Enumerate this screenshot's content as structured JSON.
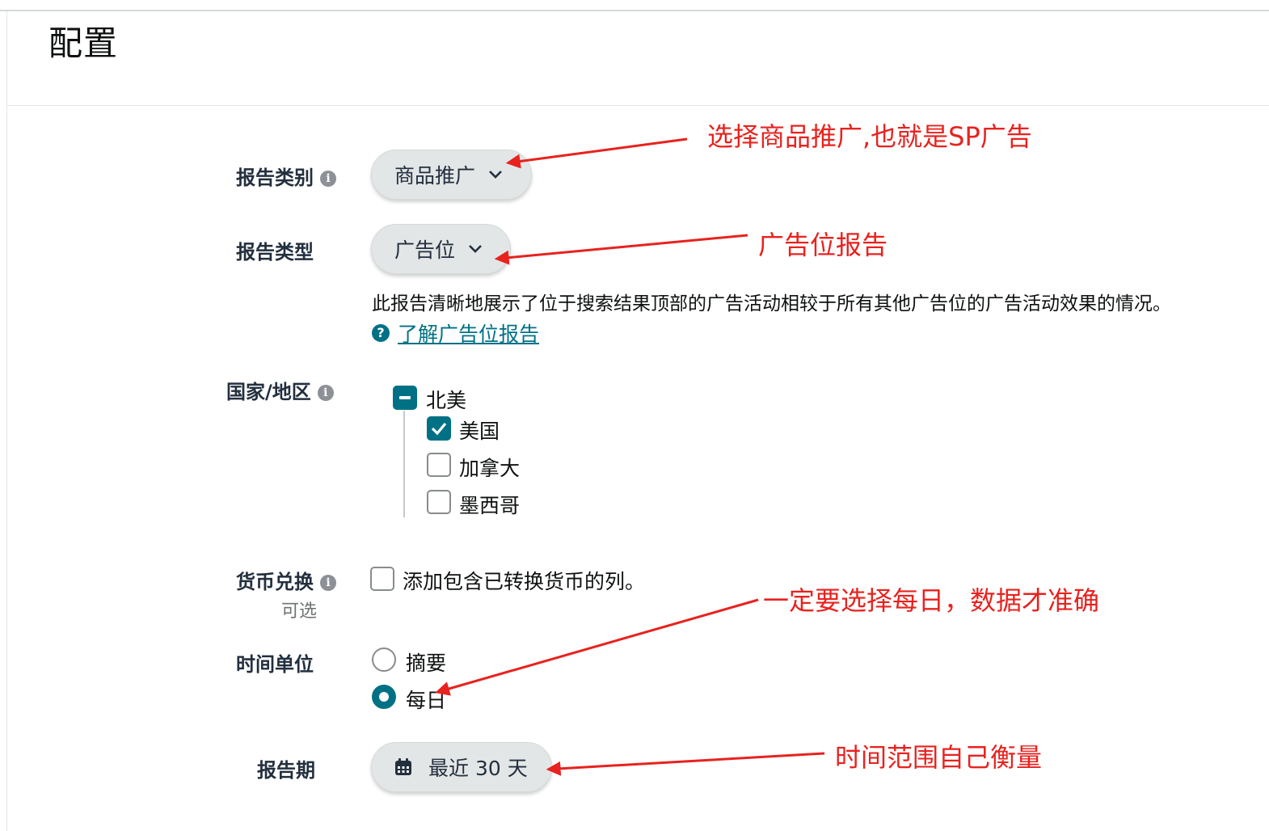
{
  "page": {
    "title": "配置"
  },
  "report_category": {
    "label": "报告类别",
    "value": "商品推广"
  },
  "report_type": {
    "label": "报告类型",
    "value": "广告位",
    "description": "此报告清晰地展示了位于搜索结果顶部的广告活动相较于所有其他广告位的广告活动效果的情况。",
    "help_link": "了解广告位报告"
  },
  "country": {
    "label": "国家/地区",
    "group": "北美",
    "options": [
      {
        "label": "美国",
        "checked": true
      },
      {
        "label": "加拿大",
        "checked": false
      },
      {
        "label": "墨西哥",
        "checked": false
      }
    ]
  },
  "currency": {
    "label": "货币兑换",
    "optional": "可选",
    "checkbox_label": "添加包含已转换货币的列。",
    "checked": false
  },
  "time_unit": {
    "label": "时间单位",
    "options": [
      {
        "label": "摘要",
        "selected": false
      },
      {
        "label": "每日",
        "selected": true
      }
    ]
  },
  "report_period": {
    "label": "报告期",
    "value": "最近 30 天"
  },
  "annotations": {
    "a1": "选择商品推广,也就是SP广告",
    "a2": "广告位报告",
    "a3": "一定要选择每日，数据才准确",
    "a4": "时间范围自己衡量"
  },
  "colors": {
    "accent": "#007185",
    "annotation": "#e8221e"
  }
}
